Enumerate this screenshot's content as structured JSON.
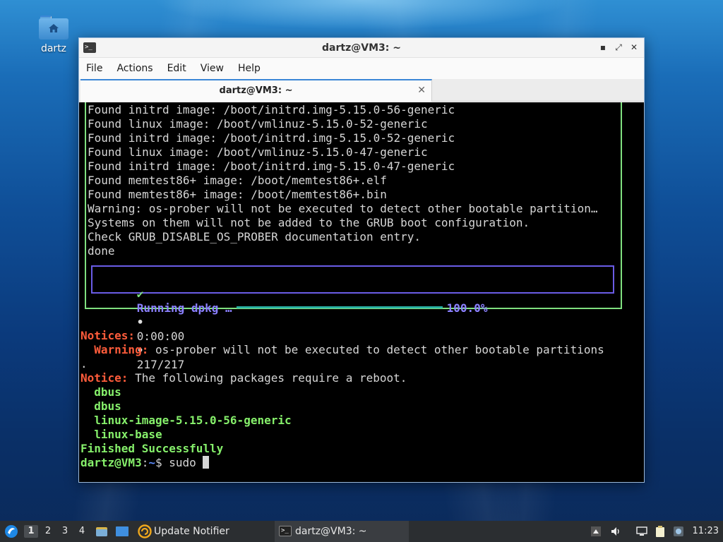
{
  "desktop": {
    "icon_label": "dartz"
  },
  "window": {
    "title": "dartz@VM3: ~",
    "controls": {
      "minimize": "▪",
      "maximize": "⤢",
      "close": "✕"
    },
    "menu": [
      "File",
      "Actions",
      "Edit",
      "View",
      "Help"
    ],
    "tab": {
      "label": "dartz@VM3: ~",
      "close": "✕"
    }
  },
  "terminal": {
    "lines": [
      "Found initrd image: /boot/initrd.img-5.15.0-56-generic",
      "Found linux image: /boot/vmlinuz-5.15.0-52-generic",
      "Found initrd image: /boot/initrd.img-5.15.0-52-generic",
      "Found linux image: /boot/vmlinuz-5.15.0-47-generic",
      "Found initrd image: /boot/initrd.img-5.15.0-47-generic",
      "Found memtest86+ image: /boot/memtest86+.elf",
      "Found memtest86+ image: /boot/memtest86+.bin",
      "Warning: os-prober will not be executed to detect other bootable partition…",
      "Systems on them will not be added to the GRUB boot configuration.",
      "Check GRUB_DISABLE_OS_PROBER documentation entry.",
      "done"
    ],
    "progress": {
      "check": "✔",
      "label": "Running dpkg …",
      "percent": "100.0%",
      "bullet": "•",
      "elapsed": "0:00:00",
      "count": "217/217"
    },
    "notices_header": "Notices:",
    "warning_label": "Warning:",
    "warning_text": " os-prober will not be executed to detect other bootable partitions",
    "warning_wrap": ".",
    "notice_label": "Notice:",
    "notice_text": " The following packages require a reboot.",
    "packages": [
      "dbus",
      "dbus",
      "linux-image-5.15.0-56-generic",
      "linux-base"
    ],
    "finished": "Finished Successfully",
    "prompt_user": "dartz@VM3",
    "prompt_colon": ":",
    "prompt_path": "~",
    "prompt_symbol": "$ ",
    "command": "sudo "
  },
  "taskbar": {
    "workspaces": [
      "1",
      "2",
      "3",
      "4"
    ],
    "update_notifier": "Update Notifier",
    "terminal_task": "dartz@VM3: ~",
    "clock": "11:23"
  }
}
